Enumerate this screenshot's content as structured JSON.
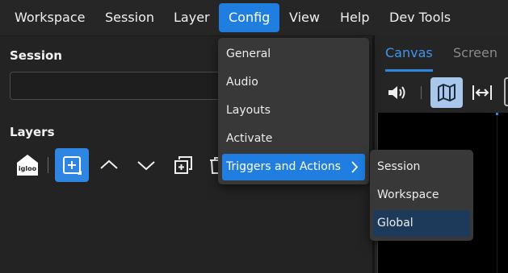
{
  "menubar": {
    "items": [
      "Workspace",
      "Session",
      "Layer",
      "Config",
      "View",
      "Help",
      "Dev Tools"
    ],
    "active": "Config"
  },
  "left": {
    "session_title": "Session",
    "session_value": "",
    "layers_title": "Layers",
    "tools": [
      "igloo-logo-icon",
      "add-layer-icon",
      "chevron-up-icon",
      "chevron-down-icon",
      "duplicate-icon",
      "trash-icon"
    ],
    "logo_text": "igloo"
  },
  "right": {
    "tabs": [
      "Canvas",
      "Screen"
    ],
    "active_tab": "Canvas",
    "tools": [
      "volume-icon",
      "map-icon",
      "fit-width-icon"
    ]
  },
  "config_menu": {
    "items": [
      "General",
      "Audio",
      "Layouts",
      "Activate",
      "Triggers and Actions"
    ],
    "highlighted": "Triggers and Actions"
  },
  "triggers_submenu": {
    "items": [
      "Session",
      "Workspace",
      "Global"
    ],
    "hovered": "Global"
  },
  "colors": {
    "accent": "#1f7ee0",
    "menu_bg": "#383838",
    "panel_bg": "#232323"
  }
}
